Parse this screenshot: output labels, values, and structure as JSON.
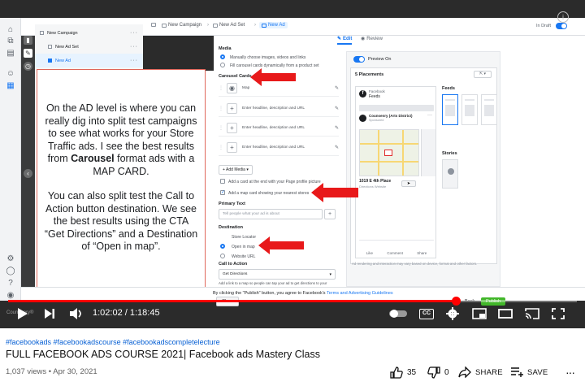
{
  "ads_manager": {
    "breadcrumb": [
      "New Campaign",
      "New Ad Set",
      "New Ad"
    ],
    "status": "In Draft",
    "tree": [
      "New Campaign",
      "New Ad Set",
      "New Ad"
    ]
  },
  "overlay": {
    "p1_before": "On the AD level is where you can really dig into split test campaigns to see what works for your Store Traffic ads. I see the best results from ",
    "p1_bold": "Carousel",
    "p1_after": " format ads with a MAP CARD.",
    "p2": "You can also split test the Call to Action button destination. We see the best results using the CTA “Get Directions” and a Destination of “Open in map”."
  },
  "editor": {
    "media_label": "Media",
    "media_option_1": "Manually choose images, videos and links",
    "media_option_2": "Fill carousel cards dynamically from a product set",
    "carousel_label": "Carousel Cards",
    "card_map": "Map",
    "card_placeholder": "Enter headline, description and URL",
    "add_media": "+ Add Media ▾",
    "add_card_end": "Add a card at the end with your Page profile picture",
    "add_map_card": "Add a map card showing your nearest stores",
    "primary_text_label": "Primary Text",
    "primary_text_placeholder": "Tell people what your ad is about",
    "destination_label": "Destination",
    "dest_store_locator": "Store Locator",
    "dest_open_in_map": "Open in map",
    "dest_website_url": "Website URL",
    "cta_label": "Call to Action",
    "cta_value": "Get Directions",
    "cta_help": "Add a link to a map so people can tap your ad to get directions to your"
  },
  "preview": {
    "tab_edit": "Edit",
    "tab_review": "Review",
    "toggle_label": "Preview On",
    "placements": "5 Placements",
    "fb_label": "Facebook",
    "feeds": "Feeds",
    "page_name": "Counsenry (Arts District)",
    "sponsored": "Sponsored",
    "place_name": "1019 E 4th Place",
    "place_sub": "Directions Website",
    "like": "Like",
    "comment": "Comment",
    "share": "Share",
    "right_feeds": "Feeds",
    "right_stories": "Stories",
    "footnote": "Ad rendering and interaction may vary based on device, format and other factors."
  },
  "bottom_bar": {
    "text_before": "By clicking the \"Publish\" button, you agree to Facebook's ",
    "link": "Terms and Advertising Guidelines",
    "close": "Close",
    "back": "Back",
    "publish": "Publish"
  },
  "player": {
    "current_time": "1:02:02",
    "duration": "1:18:45",
    "progress": 0.7878,
    "watermark": "Counsenry®"
  },
  "video_info": {
    "hashtags": "#facebookads #facebookadscourse #facebookadscompletelecture",
    "title": "FULL FACEBOOK ADS COURSE 2021| Facebook ads Mastery Class",
    "views": "1,037 views",
    "date": "Apr 30, 2021",
    "likes": "35",
    "dislikes": "0",
    "share": "SHARE",
    "save": "SAVE"
  },
  "colors": {
    "youtube_red": "#ff0000",
    "fb_blue": "#1877f2",
    "arrow_red": "#e8191a",
    "link_blue": "#065fd4"
  },
  "icons": [
    "info-icon",
    "play-icon",
    "next-icon",
    "volume-icon",
    "autoplay-toggle-icon",
    "cc-icon",
    "settings-icon",
    "miniplayer-icon",
    "theater-icon",
    "cast-icon",
    "fullscreen-icon",
    "like-icon",
    "dislike-icon",
    "share-icon",
    "save-icon",
    "more-icon"
  ]
}
